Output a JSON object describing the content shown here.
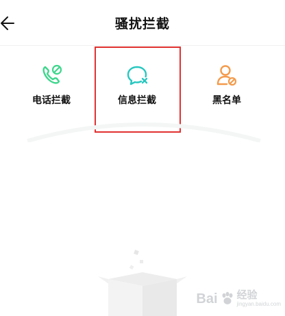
{
  "header": {
    "title": "骚扰拦截",
    "back_icon": "arrow-left-icon"
  },
  "tabs": [
    {
      "label": "电话拦截",
      "icon": "phone-block-icon",
      "color": "#3dd68c"
    },
    {
      "label": "信息拦截",
      "icon": "message-block-icon",
      "color": "#27c7c0",
      "selected": true
    },
    {
      "label": "黑名单",
      "icon": "user-block-icon",
      "color": "#f49a4a"
    }
  ],
  "highlight_color": "#e0302e",
  "watermark": {
    "brand": "Bai",
    "suffix": "经验",
    "sub": "jingyan.baidu.com"
  }
}
